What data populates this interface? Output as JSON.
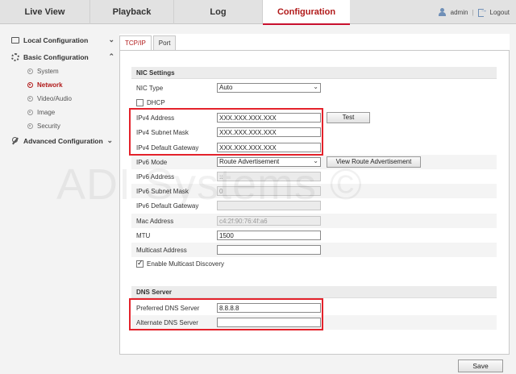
{
  "topnav": {
    "tabs": [
      {
        "label": "Live View"
      },
      {
        "label": "Playback"
      },
      {
        "label": "Log"
      },
      {
        "label": "Configuration"
      }
    ],
    "user": "admin",
    "separator": "|",
    "logout": "Logout",
    "active_color": "#c8102e"
  },
  "sidebar": {
    "local": {
      "label": "Local Configuration",
      "icon": "monitor-icon"
    },
    "basic": {
      "label": "Basic Configuration",
      "icon": "gear-icon"
    },
    "items": [
      {
        "label": "System"
      },
      {
        "label": "Network"
      },
      {
        "label": "Video/Audio"
      },
      {
        "label": "Image"
      },
      {
        "label": "Security"
      }
    ],
    "advanced": {
      "label": "Advanced Configuration",
      "icon": "wrench-icon"
    }
  },
  "subtabs": [
    {
      "label": "TCP/IP"
    },
    {
      "label": "Port"
    }
  ],
  "nic": {
    "title": "NIC Settings",
    "nic_type": {
      "label": "NIC Type",
      "value": "Auto"
    },
    "dhcp": {
      "label": "DHCP",
      "checked": false
    },
    "ipv4_address": {
      "label": "IPv4 Address",
      "value": "XXX.XXX.XXX.XXX"
    },
    "test_label": "Test",
    "ipv4_mask": {
      "label": "IPv4 Subnet Mask",
      "value": "XXX.XXX.XXX.XXX"
    },
    "ipv4_gateway": {
      "label": "IPv4 Default Gateway",
      "value": "XXX.XXX.XXX.XXX"
    },
    "ipv6_mode": {
      "label": "IPv6 Mode",
      "value": "Route Advertisement"
    },
    "view_route_label": "View Route Advertisement",
    "ipv6_address": {
      "label": "IPv6 Address",
      "value": "::"
    },
    "ipv6_mask": {
      "label": "IPv6 Subnet Mask",
      "value": "0"
    },
    "ipv6_gateway": {
      "label": "IPv6 Default Gateway",
      "value": ""
    },
    "mac": {
      "label": "Mac Address",
      "value": "c4:2f:90:76:4f:a6"
    },
    "mtu": {
      "label": "MTU",
      "value": "1500"
    },
    "multicast": {
      "label": "Multicast Address",
      "value": ""
    },
    "multicast_discovery": {
      "label": "Enable Multicast Discovery",
      "checked": true
    }
  },
  "dns": {
    "title": "DNS Server",
    "preferred": {
      "label": "Preferred DNS Server",
      "value": "8.8.8.8"
    },
    "alternate": {
      "label": "Alternate DNS Server",
      "value": ""
    }
  },
  "watermark": "ADI Systems ©",
  "save_label": "Save",
  "highlight_color": "#e4222b"
}
